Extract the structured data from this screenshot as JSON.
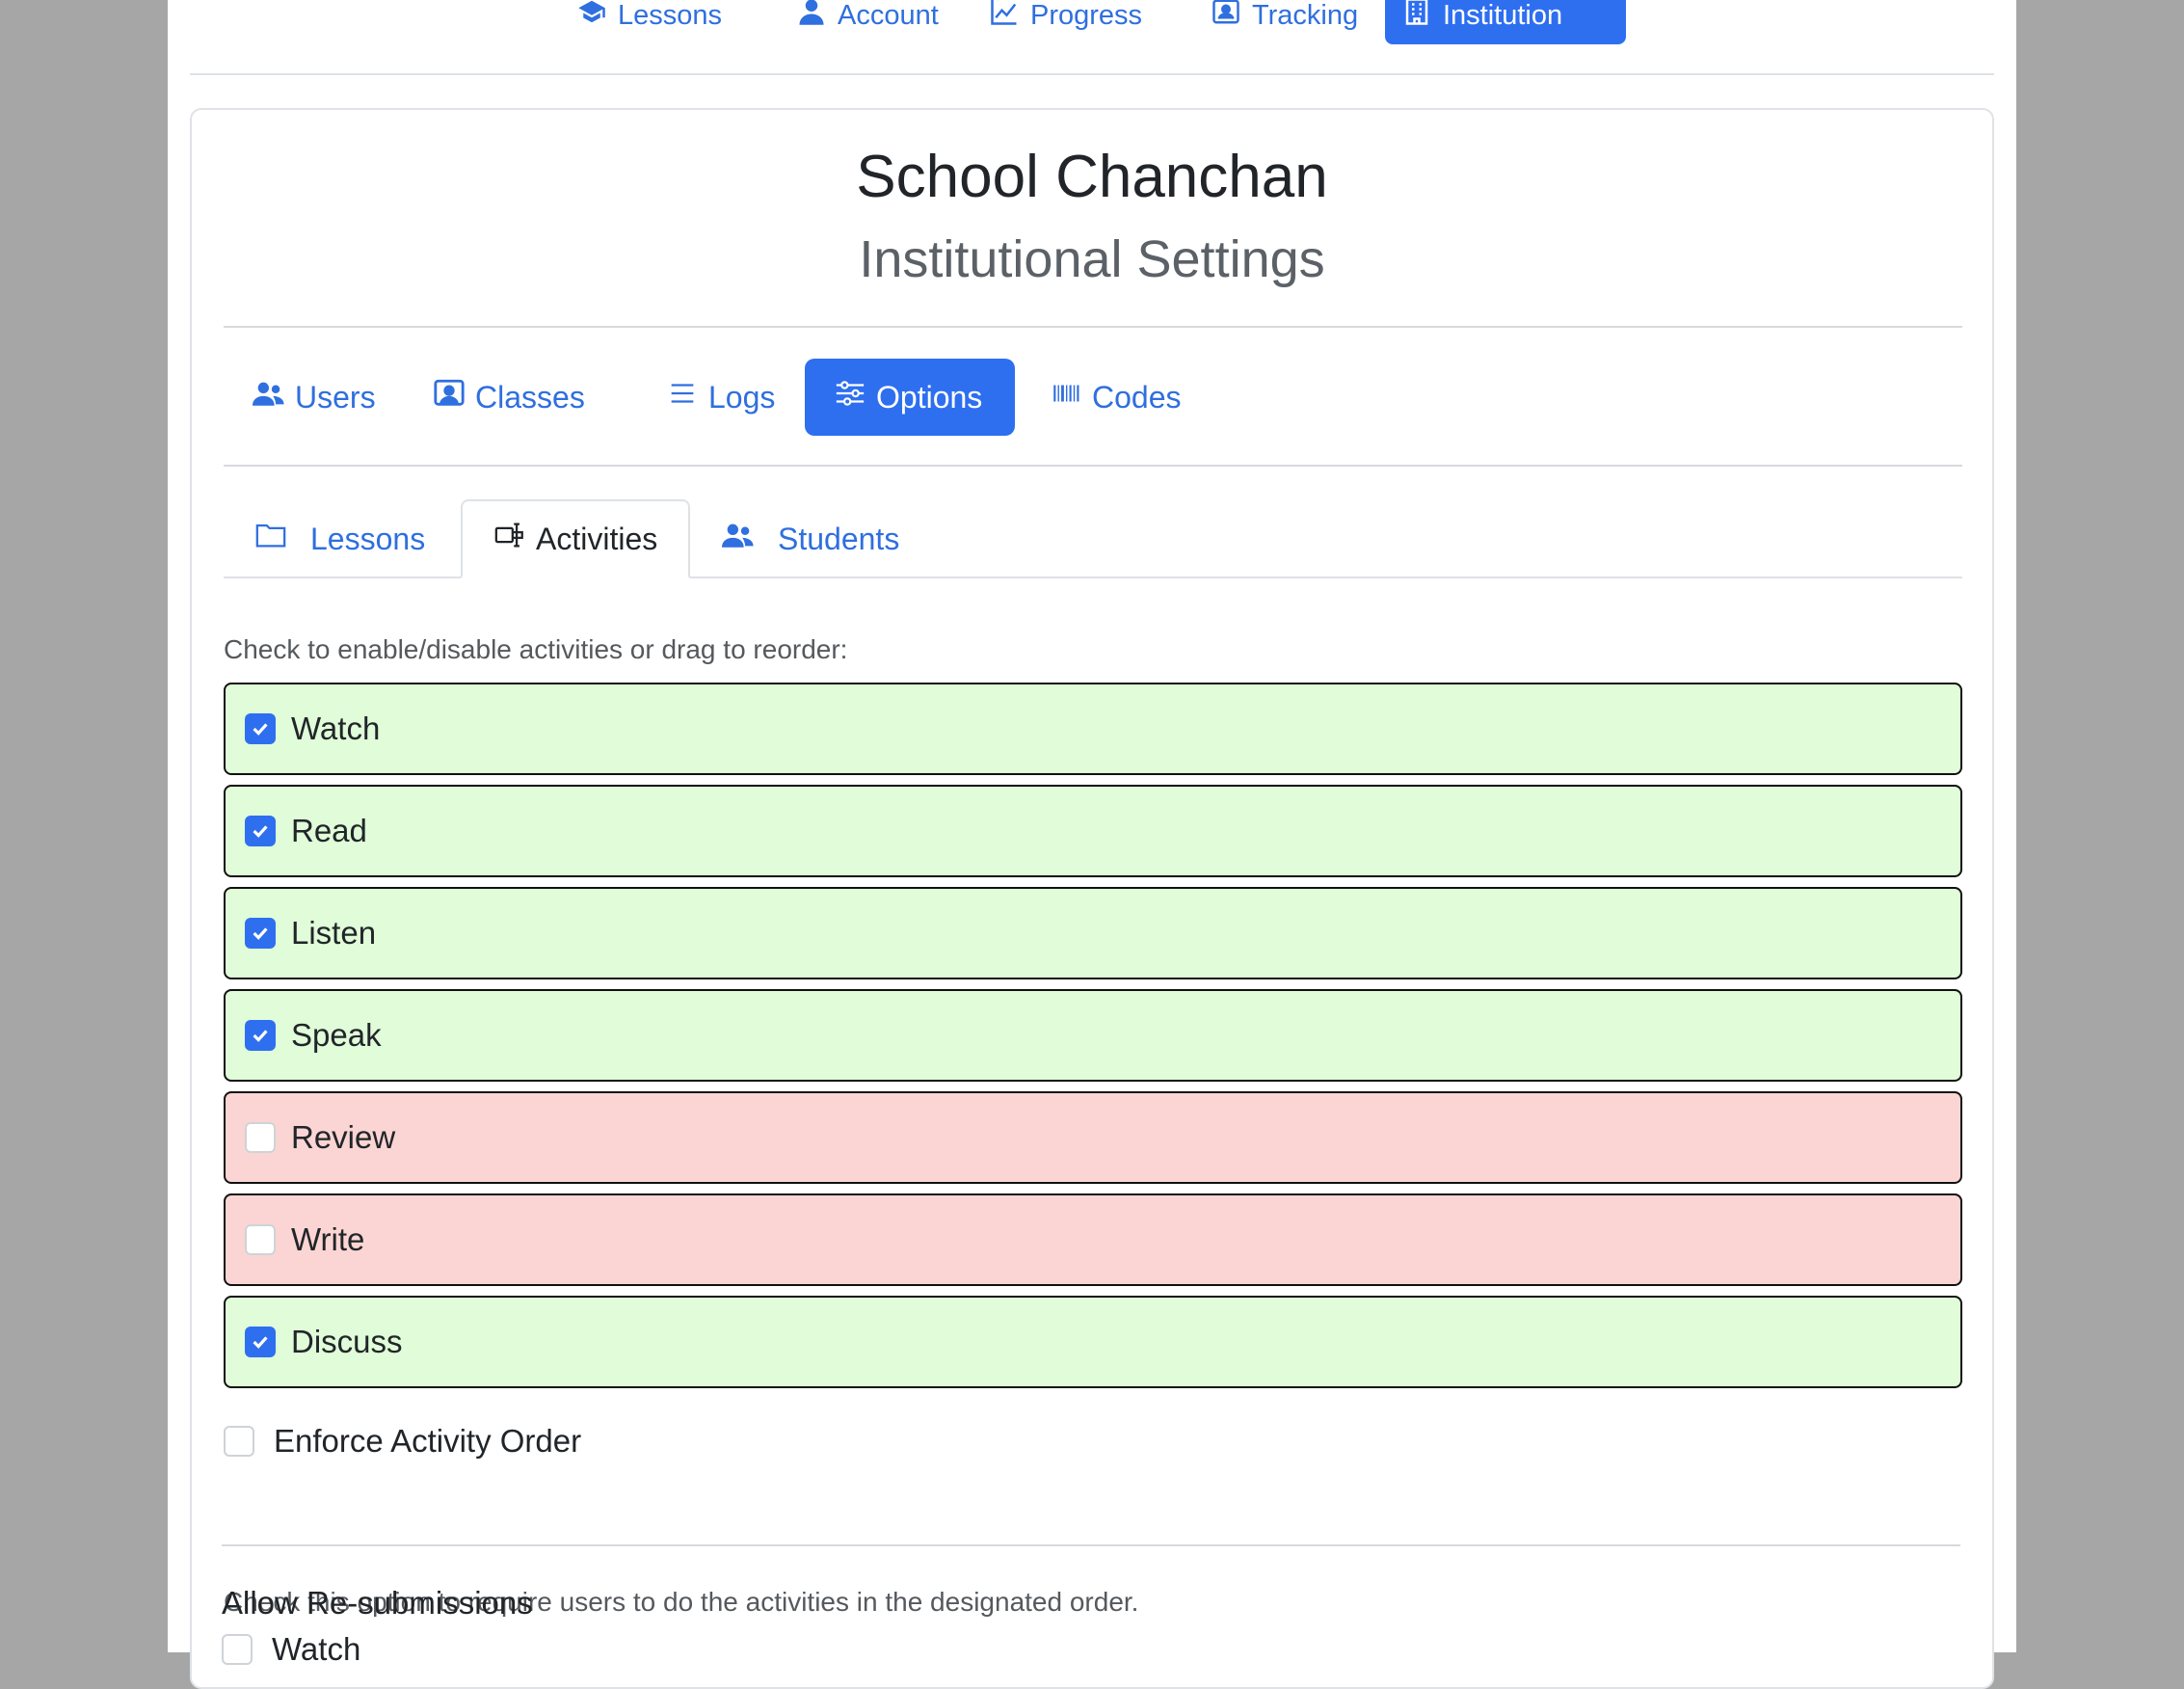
{
  "topnav": {
    "items": [
      {
        "label": "Lessons",
        "icon": "graduation-cap-icon"
      },
      {
        "label": "Account",
        "icon": "user-icon"
      },
      {
        "label": "Progress",
        "icon": "chart-line-icon"
      },
      {
        "label": "Tracking",
        "icon": "user-badge-icon"
      },
      {
        "label": "Institution",
        "icon": "building-icon"
      }
    ]
  },
  "header": {
    "title": "School Chanchan",
    "subtitle": "Institutional Settings"
  },
  "pills": [
    {
      "label": "Users",
      "icon": "users-icon"
    },
    {
      "label": "Classes",
      "icon": "classroom-icon"
    },
    {
      "label": "Logs",
      "icon": "list-icon"
    },
    {
      "label": "Options",
      "icon": "sliders-icon"
    },
    {
      "label": "Codes",
      "icon": "barcode-icon"
    }
  ],
  "tabs": [
    {
      "label": "Lessons",
      "icon": "folder-icon"
    },
    {
      "label": "Activities",
      "icon": "activities-icon"
    },
    {
      "label": "Students",
      "icon": "users-icon"
    }
  ],
  "instruction": "Check to enable/disable activities or drag to reorder:",
  "activities": [
    {
      "label": "Watch",
      "enabled": true
    },
    {
      "label": "Read",
      "enabled": true
    },
    {
      "label": "Listen",
      "enabled": true
    },
    {
      "label": "Speak",
      "enabled": true
    },
    {
      "label": "Review",
      "enabled": false
    },
    {
      "label": "Write",
      "enabled": false
    },
    {
      "label": "Discuss",
      "enabled": true
    }
  ],
  "enforce": {
    "label": "Enforce Activity Order",
    "help": "Check this option to require users to do the activities in the designated order."
  },
  "resubmissions": {
    "label": "Allow Re-submissions",
    "first_option": "Watch"
  },
  "colors": {
    "accent": "#2e6ff0",
    "enabled_bg": "#e0fcd8",
    "disabled_bg": "#fbd5d3"
  }
}
